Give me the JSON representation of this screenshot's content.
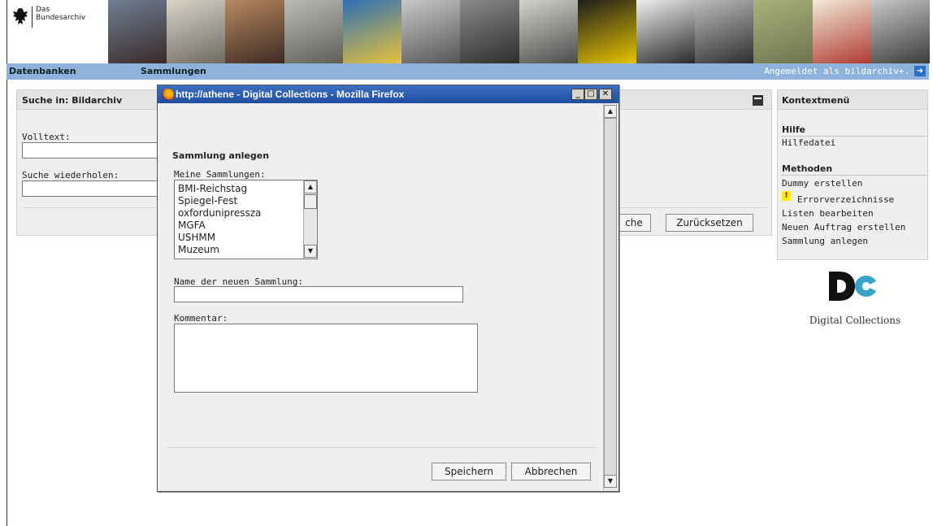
{
  "header": {
    "logo_line1": "Das",
    "logo_line2": "Bundesarchiv",
    "photos": [
      {
        "id": "p1",
        "colors": [
          "#6f7f94",
          "#3a2a28"
        ]
      },
      {
        "id": "p2",
        "colors": [
          "#d9d4c8",
          "#6d6a61"
        ]
      },
      {
        "id": "p3",
        "colors": [
          "#b98860",
          "#3c2a22"
        ]
      },
      {
        "id": "p4",
        "colors": [
          "#bcbcb6",
          "#5f5f58"
        ]
      },
      {
        "id": "p5",
        "colors": [
          "#2c6fb4",
          "#e9c23b"
        ]
      },
      {
        "id": "p6",
        "colors": [
          "#c8c8c8",
          "#555555"
        ]
      },
      {
        "id": "p7",
        "colors": [
          "#8a8a88",
          "#2d2d2b"
        ]
      },
      {
        "id": "p8",
        "colors": [
          "#d2d2cf",
          "#4b4b49"
        ]
      },
      {
        "id": "p9",
        "colors": [
          "#1d1d1b",
          "#e8c400"
        ]
      },
      {
        "id": "p10",
        "colors": [
          "#efefef",
          "#2a2a2a"
        ]
      },
      {
        "id": "p11",
        "colors": [
          "#bcbcbc",
          "#2e2e2e"
        ]
      },
      {
        "id": "p12",
        "colors": [
          "#a8b37a",
          "#6d7450"
        ]
      },
      {
        "id": "p13",
        "colors": [
          "#f1ead8",
          "#b03a30"
        ]
      },
      {
        "id": "p14",
        "colors": [
          "#c7c7c5",
          "#3b3b39"
        ]
      }
    ]
  },
  "nav": {
    "item_databases": "Datenbanken",
    "item_collections": "Sammlungen",
    "login_status": "Angemeldet als bildarchiv+.",
    "logout_icon": "logout-arrow-icon",
    "accent_color": "#8db3dd"
  },
  "search_panel": {
    "title": "Suche in: Bildarchiv",
    "fulltext_label": "Volltext:",
    "fulltext_value": "",
    "repeat_label": "Suche wiederholen:",
    "repeat_value": "",
    "search_button_visible_text": "che",
    "reset_button": "Zurücksetzen"
  },
  "context_menu": {
    "title": "Kontextmenü",
    "help_section": "Hilfe",
    "help_items": [
      "Hilfedatei"
    ],
    "methods_section": "Methoden",
    "method_items": [
      "Dummy erstellen",
      "Errorverzeichnisse",
      "Listen bearbeiten",
      "Neuen Auftrag erstellen",
      "Sammlung anlegen"
    ],
    "warning_icon": "exclamation-icon"
  },
  "brand": {
    "caption": "Digital Collections",
    "logo_color": "#111111",
    "logo_accent": "#39a3c9"
  },
  "popup": {
    "window_title": "http://athene - Digital Collections - Mozilla Firefox",
    "heading": "Sammlung anlegen",
    "list_label": "Meine Sammlungen:",
    "collections": [
      "BMI-Reichstag",
      "Spiegel-Fest",
      "oxfordunipressza",
      "MGFA",
      "USHMM",
      "Muzeum"
    ],
    "name_label": "Name der neuen Sammlung:",
    "name_value": "",
    "comment_label": "Kommentar:",
    "comment_value": "",
    "save_button": "Speichern",
    "cancel_button": "Abbrechen",
    "titlebar_color": "#2a5db0"
  }
}
